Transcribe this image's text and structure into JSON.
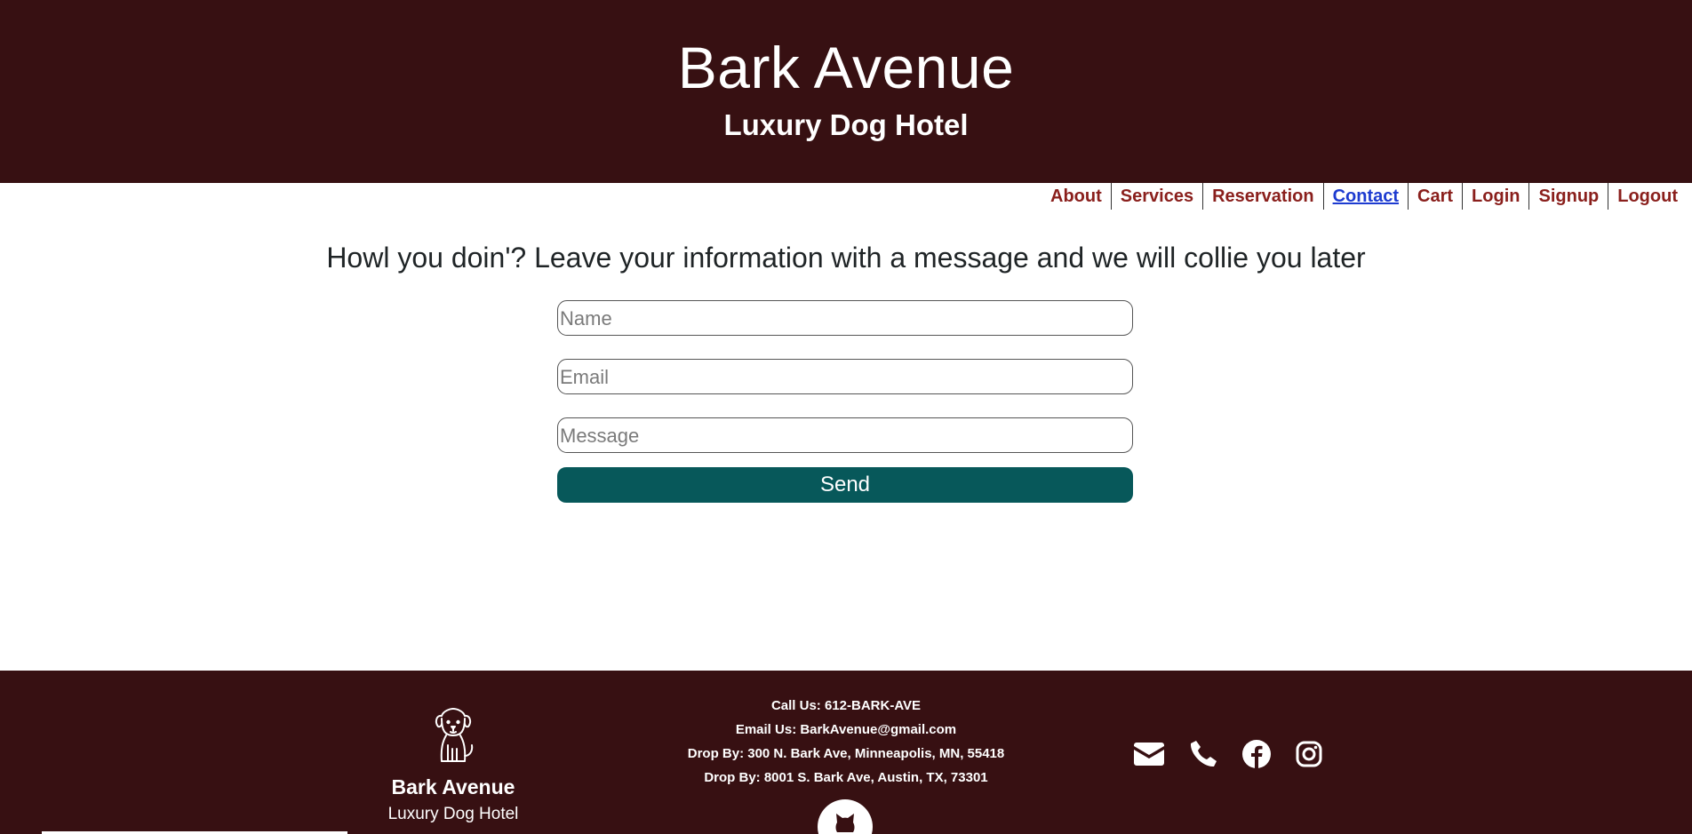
{
  "header": {
    "title": "Bark Avenue",
    "subtitle": "Luxury Dog Hotel"
  },
  "nav": {
    "items": [
      "About",
      "Services",
      "Reservation",
      "Contact",
      "Cart",
      "Login",
      "Signup",
      "Logout"
    ],
    "active": "Contact"
  },
  "main": {
    "heading": "Howl you doin'? Leave your information with a message and we will collie you later",
    "form": {
      "name_placeholder": "Name",
      "email_placeholder": "Email",
      "message_placeholder": "Message",
      "send_label": "Send"
    }
  },
  "footer": {
    "brand_name": "Bark Avenue",
    "brand_tagline": "Luxury Dog Hotel",
    "contact": [
      "Call Us: 612-BARK-AVE",
      "Email Us: BarkAvenue@gmail.com",
      "Drop By: 300 N. Bark Ave, Minneapolis, MN, 55418",
      "Drop By: 8001 S. Bark Ave, Austin, TX, 73301"
    ],
    "social_icons": [
      "envelope-icon",
      "phone-icon",
      "facebook-icon",
      "instagram-icon"
    ],
    "github_icon": "github-icon"
  },
  "colors": {
    "header_bg": "#371012",
    "nav_link": "#8a1f1c",
    "nav_active": "#1d3bd0",
    "send_button": "#07585a"
  }
}
